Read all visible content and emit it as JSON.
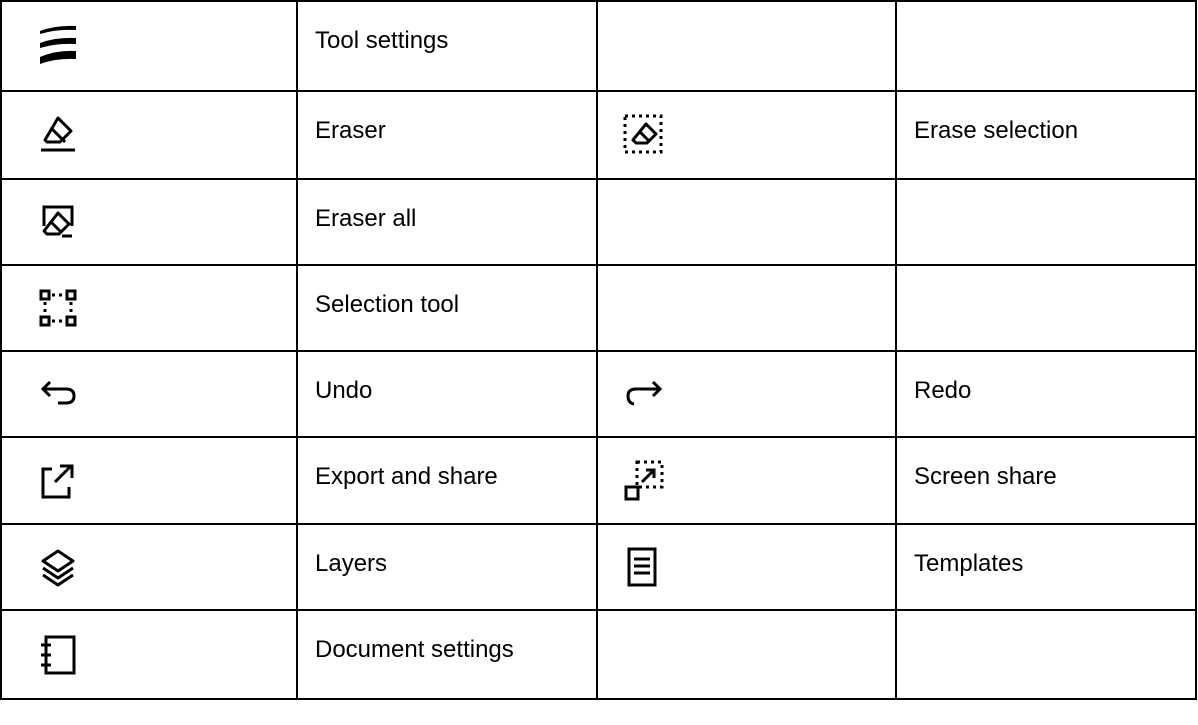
{
  "rows": [
    {
      "icon1": "tool-settings-icon",
      "label1": "Tool settings",
      "icon2": "",
      "label2": ""
    },
    {
      "icon1": "eraser-icon",
      "label1": "Eraser",
      "icon2": "erase-selection-icon",
      "label2": "Erase selection"
    },
    {
      "icon1": "eraser-all-icon",
      "label1": "Eraser all",
      "icon2": "",
      "label2": ""
    },
    {
      "icon1": "selection-tool-icon",
      "label1": "Selection tool",
      "icon2": "",
      "label2": ""
    },
    {
      "icon1": "undo-icon",
      "label1": "Undo",
      "icon2": "redo-icon",
      "label2": "Redo"
    },
    {
      "icon1": "export-share-icon",
      "label1": "Export and share",
      "icon2": "screen-share-icon",
      "label2": "Screen share"
    },
    {
      "icon1": "layers-icon",
      "label1": "Layers",
      "icon2": "templates-icon",
      "label2": "Templates"
    },
    {
      "icon1": "document-settings-icon",
      "label1": "Document settings",
      "icon2": "",
      "label2": ""
    }
  ]
}
